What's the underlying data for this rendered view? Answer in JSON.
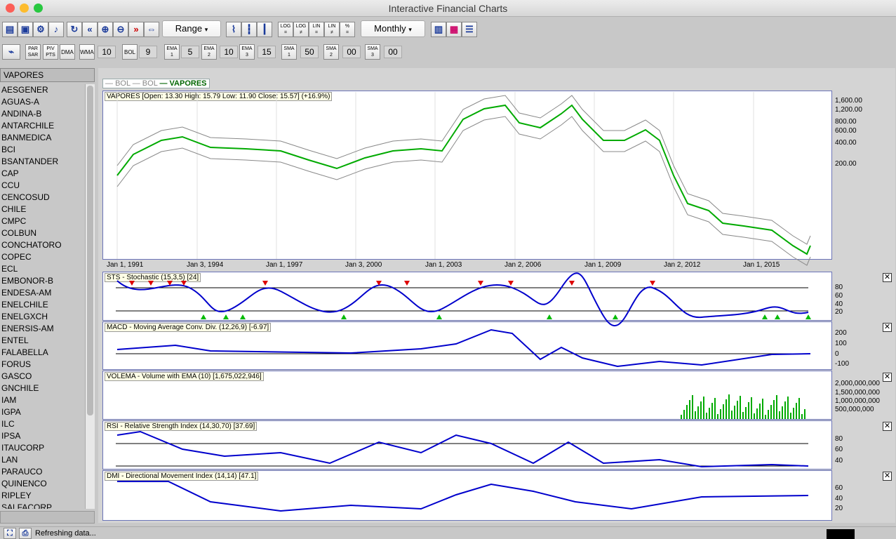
{
  "window": {
    "title": "Interactive Financial Charts",
    "traffic": {
      "close": "#fc5f57",
      "min": "#fdbc2e",
      "max": "#28c840"
    }
  },
  "toolbar": {
    "icons1": [
      "print-icon",
      "save-icon",
      "settings-icon",
      "sound-icon",
      "refresh-icon",
      "back-icon",
      "zoom-in-icon",
      "zoom-out-icon",
      "forward-icon",
      "fit-icon"
    ],
    "range_label": "Range",
    "chart_icons": [
      "line-chart-icon",
      "bar-chart-icon",
      "candle-chart-icon"
    ],
    "scale_buttons": [
      {
        "top": "LOG",
        "bottom": "="
      },
      {
        "top": "LOG",
        "bottom": "≠"
      },
      {
        "top": "LIN",
        "bottom": "="
      },
      {
        "top": "LIN",
        "bottom": "≠"
      },
      {
        "top": "%",
        "bottom": "="
      }
    ],
    "period_label": "Monthly",
    "view_icons": [
      "compare-icon",
      "color-icon",
      "table-icon"
    ]
  },
  "indicator_bar": {
    "items": [
      {
        "label": "PAR SAR"
      },
      {
        "label": "PIV PTS"
      },
      {
        "label": "DMA"
      },
      {
        "label": "WMA",
        "value": "10"
      },
      {
        "label": "BOL",
        "value": "9"
      },
      {
        "label": "EMA 1",
        "value": "5"
      },
      {
        "label": "EMA 2",
        "value": "10"
      },
      {
        "label": "EMA 3",
        "value": "15"
      },
      {
        "label": "SMA 1",
        "value": "50"
      },
      {
        "label": "SMA 2",
        "value": "00"
      },
      {
        "label": "SMA 3",
        "value": "00"
      }
    ]
  },
  "sidebar": {
    "header": "VAPORES",
    "symbols": [
      "AESGENER",
      "AGUAS-A",
      "ANDINA-B",
      "ANTARCHILE",
      "BANMEDICA",
      "BCI",
      "BSANTANDER",
      "CAP",
      "CCU",
      "CENCOSUD",
      "CHILE",
      "CMPC",
      "COLBUN",
      "CONCHATORO",
      "COPEC",
      "ECL",
      "EMBONOR-B",
      "ENDESA-AM",
      "ENELCHILE",
      "ENELGXCH",
      "ENERSIS-AM",
      "ENTEL",
      "FALABELLA",
      "FORUS",
      "GASCO",
      "GNCHILE",
      "IAM",
      "IGPA",
      "ILC",
      "IPSA",
      "ITAUCORP",
      "LAN",
      "PARAUCO",
      "QUINENCO",
      "RIPLEY",
      "SALFACORP"
    ]
  },
  "legend": {
    "items": [
      {
        "label": "BOL",
        "color": "#888888"
      },
      {
        "label": "BOL",
        "color": "#888888"
      },
      {
        "label": "VAPORES",
        "color": "#006600"
      }
    ]
  },
  "price_pane": {
    "title": "VAPORES [Open: 13.30  High: 15.79  Low: 11.90  Close: 15.57] (+16.9%)",
    "yticks": [
      "1,600.00",
      "1,200.00",
      "800.00",
      "600.00",
      "400.00",
      "200.00"
    ],
    "xticks": [
      "Jan 1, 1991",
      "Jan 3, 1994",
      "Jan 1, 1997",
      "Jan 3, 2000",
      "Jan 1, 2003",
      "Jan 2, 2006",
      "Jan 1, 2009",
      "Jan 2, 2012",
      "Jan 1, 2015"
    ]
  },
  "indicators": [
    {
      "key": "sts",
      "title": "STS - Stochastic (15,3,5) [24]",
      "yticks": [
        "80",
        "60",
        "40",
        "20"
      ]
    },
    {
      "key": "macd",
      "title": "MACD - Moving Average Conv. Div. (12,26,9) [-6.97]",
      "yticks": [
        "200",
        "100",
        "0",
        "-100"
      ]
    },
    {
      "key": "volema",
      "title": "VOLEMA - Volume with EMA (10) [1,675,022,946]",
      "yticks": [
        "2,000,000,000",
        "1,500,000,000",
        "1,000,000,000",
        "500,000,000"
      ]
    },
    {
      "key": "rsi",
      "title": "RSI - Relative Strength Index (14,30,70) [37.69]",
      "yticks": [
        "80",
        "60",
        "40"
      ]
    },
    {
      "key": "dmi",
      "title": "DMI - Directional Movement Index (14,14) [47.1]",
      "yticks": [
        "60",
        "40",
        "20"
      ]
    }
  ],
  "status": {
    "text": "Refreshing data..."
  },
  "colors": {
    "price_up": "#00aa00",
    "price_down": "#cc0000",
    "band": "#888888",
    "main_line": "#0000cc",
    "signal": "#ff9900",
    "sell_marker": "#dd0000",
    "buy_marker": "#00bb00"
  }
}
